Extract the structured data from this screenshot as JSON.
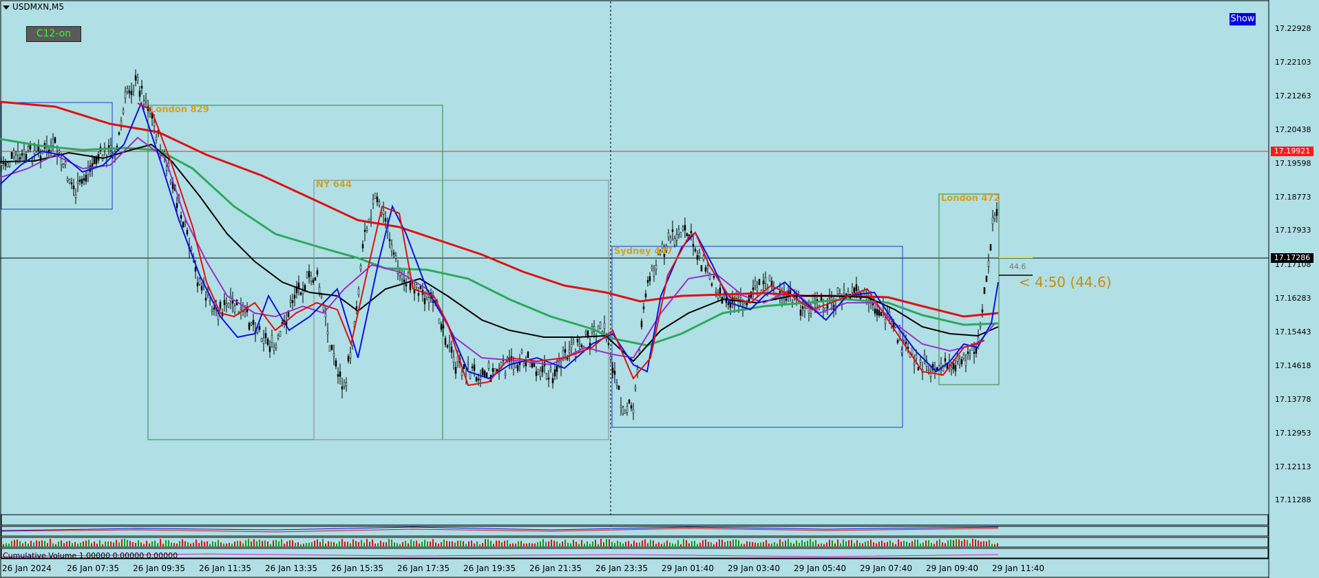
{
  "symbol": "USDMXN,M5",
  "buttons": {
    "c12": "C12-on",
    "show": "Show"
  },
  "price_axis": {
    "labels": [
      "17.22928",
      "17.22103",
      "17.21263",
      "17.20438",
      "17.19598",
      "17.18773",
      "17.17933",
      "17.17108",
      "17.16283",
      "17.15443",
      "17.14618",
      "17.13778",
      "17.12953",
      "17.12113",
      "17.11288"
    ],
    "tag_red": "17.19921",
    "tag_black": "17.17286",
    "colors": {
      "red_tag": "#ff1a1a",
      "black_tag": "#000000"
    }
  },
  "time_axis": [
    "26 Jan 2024",
    "26 Jan 07:35",
    "26 Jan 09:35",
    "26 Jan 11:35",
    "26 Jan 13:35",
    "26 Jan 15:35",
    "26 Jan 17:35",
    "26 Jan 19:35",
    "26 Jan 21:35",
    "26 Jan 23:35",
    "29 Jan 01:40",
    "29 Jan 03:40",
    "29 Jan 05:40",
    "29 Jan 07:40",
    "29 Jan 09:40",
    "29 Jan 11:40"
  ],
  "sessions": [
    {
      "label": "London 829",
      "color": "#2a8a2a"
    },
    {
      "label": "NY 644",
      "color": "#888888"
    },
    {
      "label": "Sydney 447",
      "color": "#1a3acc"
    },
    {
      "label": "London 472",
      "color": "#2a8a2a"
    }
  ],
  "countdown": "< 4:50 (44.6)",
  "spread_small": "44.6",
  "indicators": {
    "cumulative_volume": "Cumulative Volume 1.00000 0.00000 0.00000"
  },
  "colors": {
    "background": "#b0dfe5",
    "ma_red": "#e01010",
    "ma_green": "#2aaa5a",
    "ma_black": "#000000",
    "ma_blue": "#1010e0",
    "ma_purple": "#9a30c8",
    "label_gold": "#d8a020"
  }
}
